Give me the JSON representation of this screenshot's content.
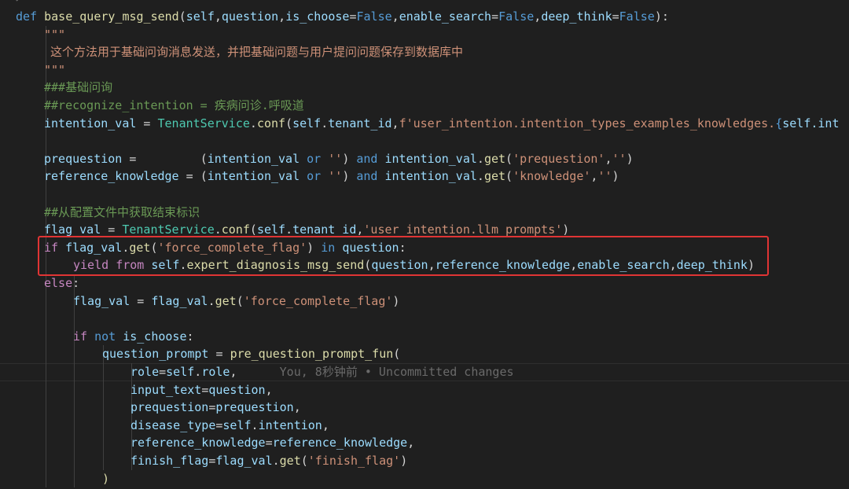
{
  "blame": "You, 8秒钟前 • Uncommitted changes",
  "lines": [
    {
      "indent": 20,
      "tokens": [
        {
          "t": "def ",
          "c": "kw"
        },
        {
          "t": "base_query_msg_send",
          "c": "fn"
        },
        {
          "t": "(",
          "c": "plain"
        },
        {
          "t": "self",
          "c": "var"
        },
        {
          "t": ",",
          "c": "plain"
        },
        {
          "t": "question",
          "c": "var"
        },
        {
          "t": ",",
          "c": "plain"
        },
        {
          "t": "is_choose",
          "c": "var"
        },
        {
          "t": "=",
          "c": "plain"
        },
        {
          "t": "False",
          "c": "kw"
        },
        {
          "t": ",",
          "c": "plain"
        },
        {
          "t": "enable_search",
          "c": "var"
        },
        {
          "t": "=",
          "c": "plain"
        },
        {
          "t": "False",
          "c": "kw"
        },
        {
          "t": ",",
          "c": "plain"
        },
        {
          "t": "deep_think",
          "c": "var"
        },
        {
          "t": "=",
          "c": "plain"
        },
        {
          "t": "False",
          "c": "kw"
        },
        {
          "t": "):",
          "c": "plain"
        }
      ]
    },
    {
      "indent": 56,
      "tokens": [
        {
          "t": "\"\"\"",
          "c": "doc"
        }
      ]
    },
    {
      "indent": 64,
      "tokens": [
        {
          "t": "这个方法用于基础问询消息发送，并把基础问题与用户提问问题保存到数据库中",
          "c": "doc"
        }
      ]
    },
    {
      "indent": 56,
      "tokens": [
        {
          "t": "\"\"\"",
          "c": "doc"
        }
      ]
    },
    {
      "indent": 56,
      "tokens": [
        {
          "t": "###基础问询",
          "c": "cm"
        }
      ]
    },
    {
      "indent": 56,
      "tokens": [
        {
          "t": "##recognize_intention = 疾病问诊.呼吸道",
          "c": "cm"
        }
      ]
    },
    {
      "indent": 56,
      "tokens": [
        {
          "t": "intention_val",
          "c": "var"
        },
        {
          "t": " = ",
          "c": "plain"
        },
        {
          "t": "TenantService",
          "c": "cls"
        },
        {
          "t": ".",
          "c": "plain"
        },
        {
          "t": "conf",
          "c": "fn"
        },
        {
          "t": "(",
          "c": "plain"
        },
        {
          "t": "self",
          "c": "self"
        },
        {
          "t": ".",
          "c": "plain"
        },
        {
          "t": "tenant_id",
          "c": "var"
        },
        {
          "t": ",",
          "c": "plain"
        },
        {
          "t": "f'user_intention.intention_types_examples_knowledges.",
          "c": "str"
        },
        {
          "t": "{",
          "c": "kw"
        },
        {
          "t": "self",
          "c": "self"
        },
        {
          "t": ".int",
          "c": "var"
        }
      ]
    },
    {
      "indent": 56,
      "tokens": []
    },
    {
      "indent": 56,
      "tokens": [
        {
          "t": "prequestion",
          "c": "var"
        },
        {
          "t": " =         ",
          "c": "plain"
        },
        {
          "t": "(",
          "c": "plain"
        },
        {
          "t": "intention_val",
          "c": "var"
        },
        {
          "t": " or ",
          "c": "kw"
        },
        {
          "t": "''",
          "c": "str"
        },
        {
          "t": ") ",
          "c": "plain"
        },
        {
          "t": "and",
          "c": "kw"
        },
        {
          "t": " ",
          "c": "plain"
        },
        {
          "t": "intention_val",
          "c": "var"
        },
        {
          "t": ".",
          "c": "plain"
        },
        {
          "t": "get",
          "c": "fn"
        },
        {
          "t": "(",
          "c": "plain"
        },
        {
          "t": "'prequestion'",
          "c": "str"
        },
        {
          "t": ",",
          "c": "plain"
        },
        {
          "t": "''",
          "c": "str"
        },
        {
          "t": ")",
          "c": "plain"
        }
      ]
    },
    {
      "indent": 56,
      "tokens": [
        {
          "t": "reference_knowledge",
          "c": "var"
        },
        {
          "t": " = ",
          "c": "plain"
        },
        {
          "t": "(",
          "c": "plain"
        },
        {
          "t": "intention_val",
          "c": "var"
        },
        {
          "t": " or ",
          "c": "kw"
        },
        {
          "t": "''",
          "c": "str"
        },
        {
          "t": ") ",
          "c": "plain"
        },
        {
          "t": "and",
          "c": "kw"
        },
        {
          "t": " ",
          "c": "plain"
        },
        {
          "t": "intention_val",
          "c": "var"
        },
        {
          "t": ".",
          "c": "plain"
        },
        {
          "t": "get",
          "c": "fn"
        },
        {
          "t": "(",
          "c": "plain"
        },
        {
          "t": "'knowledge'",
          "c": "str"
        },
        {
          "t": ",",
          "c": "plain"
        },
        {
          "t": "''",
          "c": "str"
        },
        {
          "t": ")",
          "c": "plain"
        }
      ]
    },
    {
      "indent": 56,
      "tokens": []
    },
    {
      "indent": 56,
      "tokens": [
        {
          "t": "##从配置文件中获取结束标识",
          "c": "cm"
        }
      ]
    },
    {
      "indent": 56,
      "tokens": [
        {
          "t": "flag_val",
          "c": "var"
        },
        {
          "t": " = ",
          "c": "plain"
        },
        {
          "t": "TenantService",
          "c": "cls"
        },
        {
          "t": ".",
          "c": "plain"
        },
        {
          "t": "conf",
          "c": "fn"
        },
        {
          "t": "(",
          "c": "plain"
        },
        {
          "t": "self",
          "c": "self"
        },
        {
          "t": ".",
          "c": "plain"
        },
        {
          "t": "tenant_id",
          "c": "var"
        },
        {
          "t": ",",
          "c": "plain"
        },
        {
          "t": "'user_intention.llm_prompts'",
          "c": "str"
        },
        {
          "t": ")",
          "c": "plain"
        }
      ]
    },
    {
      "indent": 56,
      "tokens": [
        {
          "t": "if",
          "c": "ctrl"
        },
        {
          "t": " ",
          "c": "plain"
        },
        {
          "t": "flag_val",
          "c": "var"
        },
        {
          "t": ".",
          "c": "plain"
        },
        {
          "t": "get",
          "c": "fn"
        },
        {
          "t": "(",
          "c": "plain"
        },
        {
          "t": "'force_complete_flag'",
          "c": "str"
        },
        {
          "t": ") ",
          "c": "plain"
        },
        {
          "t": "in",
          "c": "kw"
        },
        {
          "t": " ",
          "c": "plain"
        },
        {
          "t": "question",
          "c": "var"
        },
        {
          "t": ":",
          "c": "plain"
        }
      ]
    },
    {
      "indent": 93,
      "tokens": [
        {
          "t": "yield",
          "c": "ctrl"
        },
        {
          "t": " ",
          "c": "plain"
        },
        {
          "t": "from",
          "c": "ctrl"
        },
        {
          "t": " ",
          "c": "plain"
        },
        {
          "t": "self",
          "c": "self"
        },
        {
          "t": ".",
          "c": "plain"
        },
        {
          "t": "expert_diagnosis_msg_send",
          "c": "fn"
        },
        {
          "t": "(",
          "c": "plain"
        },
        {
          "t": "question",
          "c": "var"
        },
        {
          "t": ",",
          "c": "plain"
        },
        {
          "t": "reference_knowledge",
          "c": "var"
        },
        {
          "t": ",",
          "c": "plain"
        },
        {
          "t": "enable_search",
          "c": "var"
        },
        {
          "t": ",",
          "c": "plain"
        },
        {
          "t": "deep_think",
          "c": "var"
        },
        {
          "t": ")",
          "c": "plain"
        }
      ]
    },
    {
      "indent": 56,
      "tokens": [
        {
          "t": "else",
          "c": "ctrl"
        },
        {
          "t": ":",
          "c": "plain"
        }
      ]
    },
    {
      "indent": 93,
      "tokens": [
        {
          "t": "flag_val",
          "c": "var"
        },
        {
          "t": " = ",
          "c": "plain"
        },
        {
          "t": "flag_val",
          "c": "var"
        },
        {
          "t": ".",
          "c": "plain"
        },
        {
          "t": "get",
          "c": "fn"
        },
        {
          "t": "(",
          "c": "plain"
        },
        {
          "t": "'force_complete_flag'",
          "c": "str"
        },
        {
          "t": ")",
          "c": "plain"
        }
      ]
    },
    {
      "indent": 93,
      "tokens": []
    },
    {
      "indent": 93,
      "tokens": [
        {
          "t": "if",
          "c": "ctrl"
        },
        {
          "t": " ",
          "c": "plain"
        },
        {
          "t": "not",
          "c": "kw"
        },
        {
          "t": " ",
          "c": "plain"
        },
        {
          "t": "is_choose",
          "c": "var"
        },
        {
          "t": ":",
          "c": "plain"
        }
      ]
    },
    {
      "indent": 130,
      "tokens": [
        {
          "t": "question_prompt",
          "c": "var"
        },
        {
          "t": " = ",
          "c": "plain"
        },
        {
          "t": "pre_question_prompt_fun",
          "c": "fn"
        },
        {
          "t": "(",
          "c": "plain"
        }
      ]
    },
    {
      "indent": 166,
      "blame": true,
      "tokens": [
        {
          "t": "role",
          "c": "var"
        },
        {
          "t": "=",
          "c": "plain"
        },
        {
          "t": "self",
          "c": "self"
        },
        {
          "t": ".",
          "c": "plain"
        },
        {
          "t": "role",
          "c": "var"
        },
        {
          "t": ",",
          "c": "plain"
        }
      ]
    },
    {
      "indent": 166,
      "tokens": [
        {
          "t": "input_text",
          "c": "var"
        },
        {
          "t": "=",
          "c": "plain"
        },
        {
          "t": "question",
          "c": "var"
        },
        {
          "t": ",",
          "c": "plain"
        }
      ]
    },
    {
      "indent": 166,
      "tokens": [
        {
          "t": "prequestion",
          "c": "var"
        },
        {
          "t": "=",
          "c": "plain"
        },
        {
          "t": "prequestion",
          "c": "var"
        },
        {
          "t": ",",
          "c": "plain"
        }
      ]
    },
    {
      "indent": 166,
      "tokens": [
        {
          "t": "disease_type",
          "c": "var"
        },
        {
          "t": "=",
          "c": "plain"
        },
        {
          "t": "self",
          "c": "self"
        },
        {
          "t": ".",
          "c": "plain"
        },
        {
          "t": "intention",
          "c": "var"
        },
        {
          "t": ",",
          "c": "plain"
        }
      ]
    },
    {
      "indent": 166,
      "tokens": [
        {
          "t": "reference_knowledge",
          "c": "var"
        },
        {
          "t": "=",
          "c": "plain"
        },
        {
          "t": "reference_knowledge",
          "c": "var"
        },
        {
          "t": ",",
          "c": "plain"
        }
      ]
    },
    {
      "indent": 166,
      "tokens": [
        {
          "t": "finish_flag",
          "c": "var"
        },
        {
          "t": "=",
          "c": "plain"
        },
        {
          "t": "flag_val",
          "c": "var"
        },
        {
          "t": ".",
          "c": "plain"
        },
        {
          "t": "get",
          "c": "fn"
        },
        {
          "t": "(",
          "c": "plain"
        },
        {
          "t": "'finish_flag'",
          "c": "str"
        },
        {
          "t": ")",
          "c": "plain"
        }
      ]
    },
    {
      "indent": 130,
      "tokens": [
        {
          "t": ")",
          "c": "fn"
        }
      ]
    }
  ]
}
